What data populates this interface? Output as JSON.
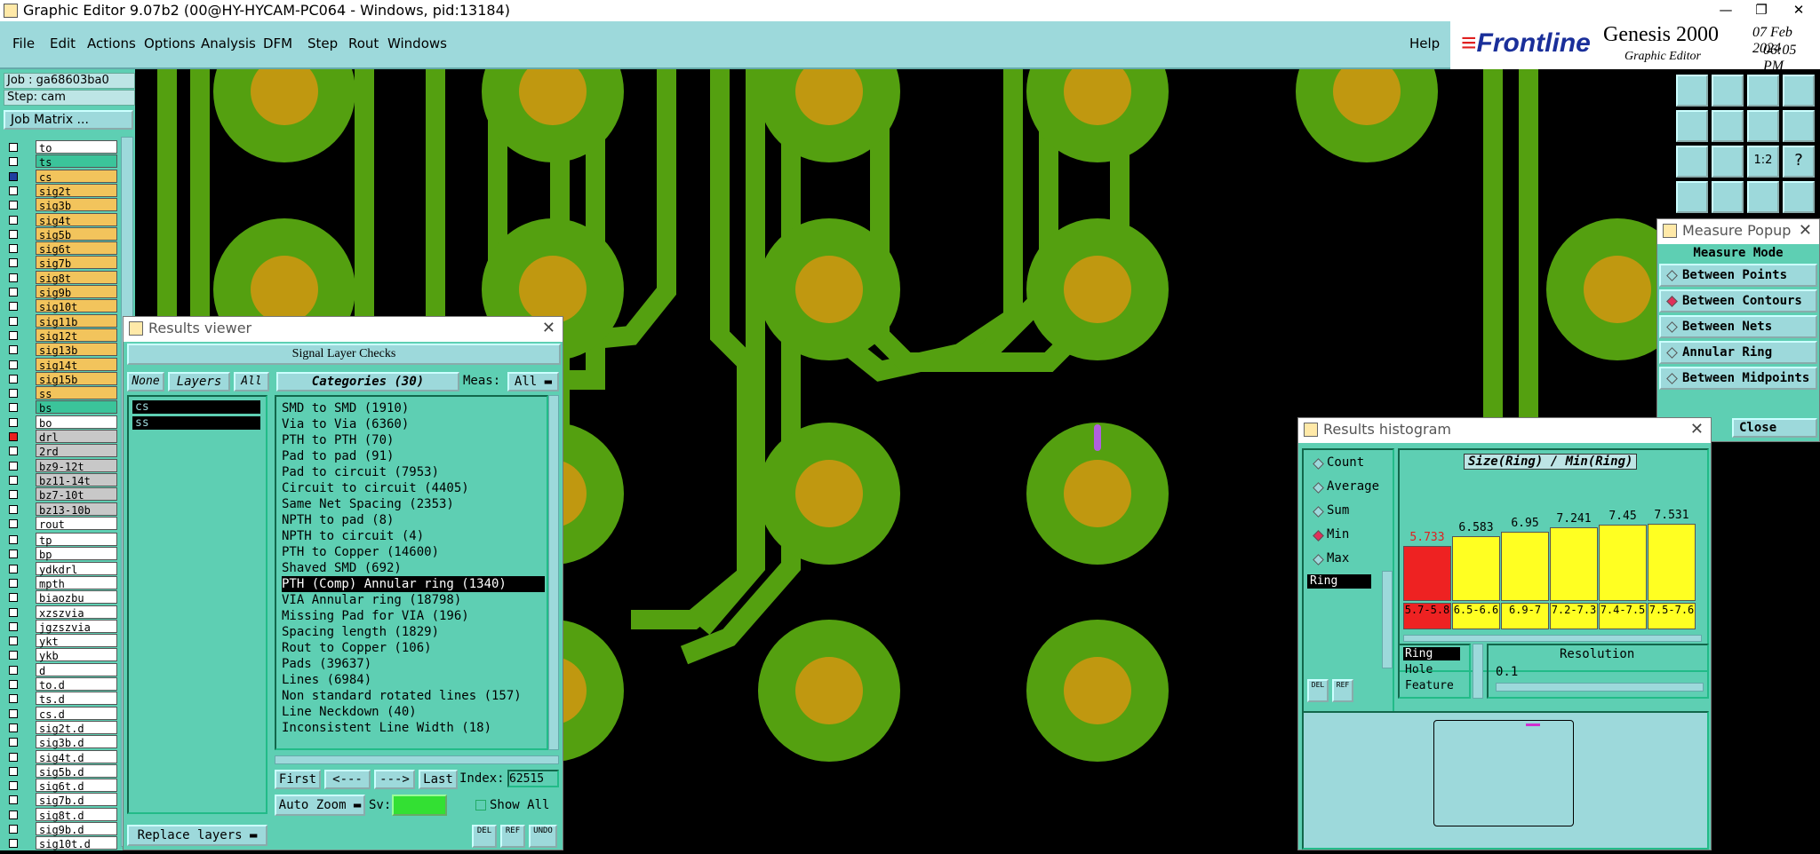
{
  "window": {
    "title": "Graphic Editor 9.07b2 (00@HY-HYCAM-PC064 - Windows, pid:13184)"
  },
  "menu": [
    "File",
    "Edit",
    "Actions",
    "Options",
    "Analysis",
    "DFM",
    "Step",
    "Rout",
    "Windows"
  ],
  "help": "Help",
  "brand": {
    "logo": "Frontline",
    "product": "Genesis 2000",
    "subtitle": "Graphic Editor",
    "date": "07 Feb 2024",
    "time": "06:05 PM"
  },
  "job": {
    "job": "Job : ga68603ba0",
    "step": "Step: cam",
    "matrix": "Job Matrix ..."
  },
  "layers_group1": [
    {
      "name": "to",
      "color": "#ffffff"
    },
    {
      "name": "ts",
      "color": "#3bc49a"
    },
    {
      "name": "cs",
      "color": "#f2c45c",
      "active": true
    },
    {
      "name": "sig2t",
      "color": "#f2c45c"
    },
    {
      "name": "sig3b",
      "color": "#f2c45c"
    },
    {
      "name": "sig4t",
      "color": "#f2c45c"
    },
    {
      "name": "sig5b",
      "color": "#f2c45c"
    },
    {
      "name": "sig6t",
      "color": "#f2c45c"
    },
    {
      "name": "sig7b",
      "color": "#f2c45c"
    },
    {
      "name": "sig8t",
      "color": "#f2c45c"
    },
    {
      "name": "sig9b",
      "color": "#f2c45c"
    },
    {
      "name": "sig10t",
      "color": "#f2c45c"
    },
    {
      "name": "sig11b",
      "color": "#f2c45c"
    },
    {
      "name": "sig12t",
      "color": "#f2c45c"
    },
    {
      "name": "sig13b",
      "color": "#f2c45c"
    },
    {
      "name": "sig14t",
      "color": "#f2c45c"
    },
    {
      "name": "sig15b",
      "color": "#f2c45c"
    },
    {
      "name": "ss",
      "color": "#f2c45c"
    },
    {
      "name": "bs",
      "color": "#3bc49a"
    },
    {
      "name": "bo",
      "color": "#ffffff"
    }
  ],
  "layers_group2": [
    {
      "name": "drl",
      "color": "#c8c8c8"
    },
    {
      "name": "2rd",
      "color": "#c8c8c8"
    },
    {
      "name": "bz9-12t",
      "color": "#c8c8c8"
    },
    {
      "name": "bz11-14t",
      "color": "#c8c8c8"
    },
    {
      "name": "bz7-10t",
      "color": "#c8c8c8"
    },
    {
      "name": "bz13-10b",
      "color": "#c8c8c8"
    },
    {
      "name": "rout",
      "color": "#ffffff"
    }
  ],
  "layers_group3": [
    "tp",
    "bp",
    "ydkdrl",
    "mpth",
    "biaozbu",
    "xzszvia",
    "jgzszvia",
    "ykt",
    "ykb",
    "d",
    "to.d",
    "ts.d",
    "cs.d",
    "sig2t.d",
    "sig3b.d",
    "sig4t.d",
    "sig5b.d",
    "sig6t.d",
    "sig7b.d",
    "sig8t.d",
    "sig9b.d",
    "sig10t.d"
  ],
  "results_viewer": {
    "title": "Results viewer",
    "header": "Signal Layer Checks",
    "none": "None",
    "layers": "Layers",
    "all": "All",
    "categories_label": "Categories (30)",
    "meas_label": "Meas:",
    "meas_value": "All",
    "layer_list": [
      "cs",
      "ss"
    ],
    "categories": [
      "SMD to SMD (1910)",
      "Via to Via (6360)",
      "PTH to PTH (70)",
      "Pad to pad (91)",
      "Pad to circuit (7953)",
      "Circuit to circuit (4405)",
      "Same Net Spacing (2353)",
      "NPTH to pad (8)",
      "NPTH to circuit (4)",
      "PTH to Copper (14600)",
      "Shaved SMD (692)",
      "PTH (Comp) Annular ring (1340)",
      "VIA Annular ring (18798)",
      "Missing Pad for VIA (196)",
      "Spacing length (1829)",
      "Rout to Copper (106)",
      "Pads (39637)",
      "Lines (6984)",
      "Non standard rotated lines (157)",
      "Line Neckdown (40)",
      "Inconsistent Line Width (18)"
    ],
    "selected_index": 11,
    "first": "First",
    "prev": "<---",
    "next": "--->",
    "last": "Last",
    "index_label": "Index:",
    "index_value": "62515",
    "zoom": "Auto Zoom",
    "sv_label": "Sv:",
    "show_all": "Show All",
    "replace_layers": "Replace layers",
    "tool_del": "DEL",
    "tool_ref": "REF",
    "tool_undo": "UNDO"
  },
  "measure_popup": {
    "title": "Measure Popup",
    "mode_label": "Measure Mode",
    "modes": [
      "Between Points",
      "Between Contours",
      "Between Nets",
      "Annular Ring",
      "Between Midpoints"
    ],
    "selected": 1,
    "close": "Close"
  },
  "histogram": {
    "title": "Results histogram",
    "options": [
      "Count",
      "Average",
      "Sum",
      "Min",
      "Max"
    ],
    "selected": 3,
    "field": "Ring",
    "chart_title": "Size(Ring) / Min(Ring)",
    "bars": [
      {
        "value": "5.733",
        "range": "5.7-5.8",
        "color": "#ee2222",
        "frac": 0.56
      },
      {
        "value": "6.583",
        "range": "6.5-6.6",
        "color": "#ffff22",
        "frac": 0.66
      },
      {
        "value": "6.95",
        "range": "6.9-7",
        "color": "#ffff22",
        "frac": 0.71
      },
      {
        "value": "7.241",
        "range": "7.2-7.3",
        "color": "#ffff22",
        "frac": 0.75
      },
      {
        "value": "7.45",
        "range": "7.4-7.5",
        "color": "#ffff22",
        "frac": 0.78
      },
      {
        "value": "7.531",
        "range": "7.5-7.6",
        "color": "#ffff22",
        "frac": 0.79
      }
    ],
    "attrs": [
      "Ring",
      "Hole",
      "Feature"
    ],
    "resolution_label": "Resolution",
    "resolution_value": "0.1",
    "del": "DEL",
    "ref": "REF"
  }
}
